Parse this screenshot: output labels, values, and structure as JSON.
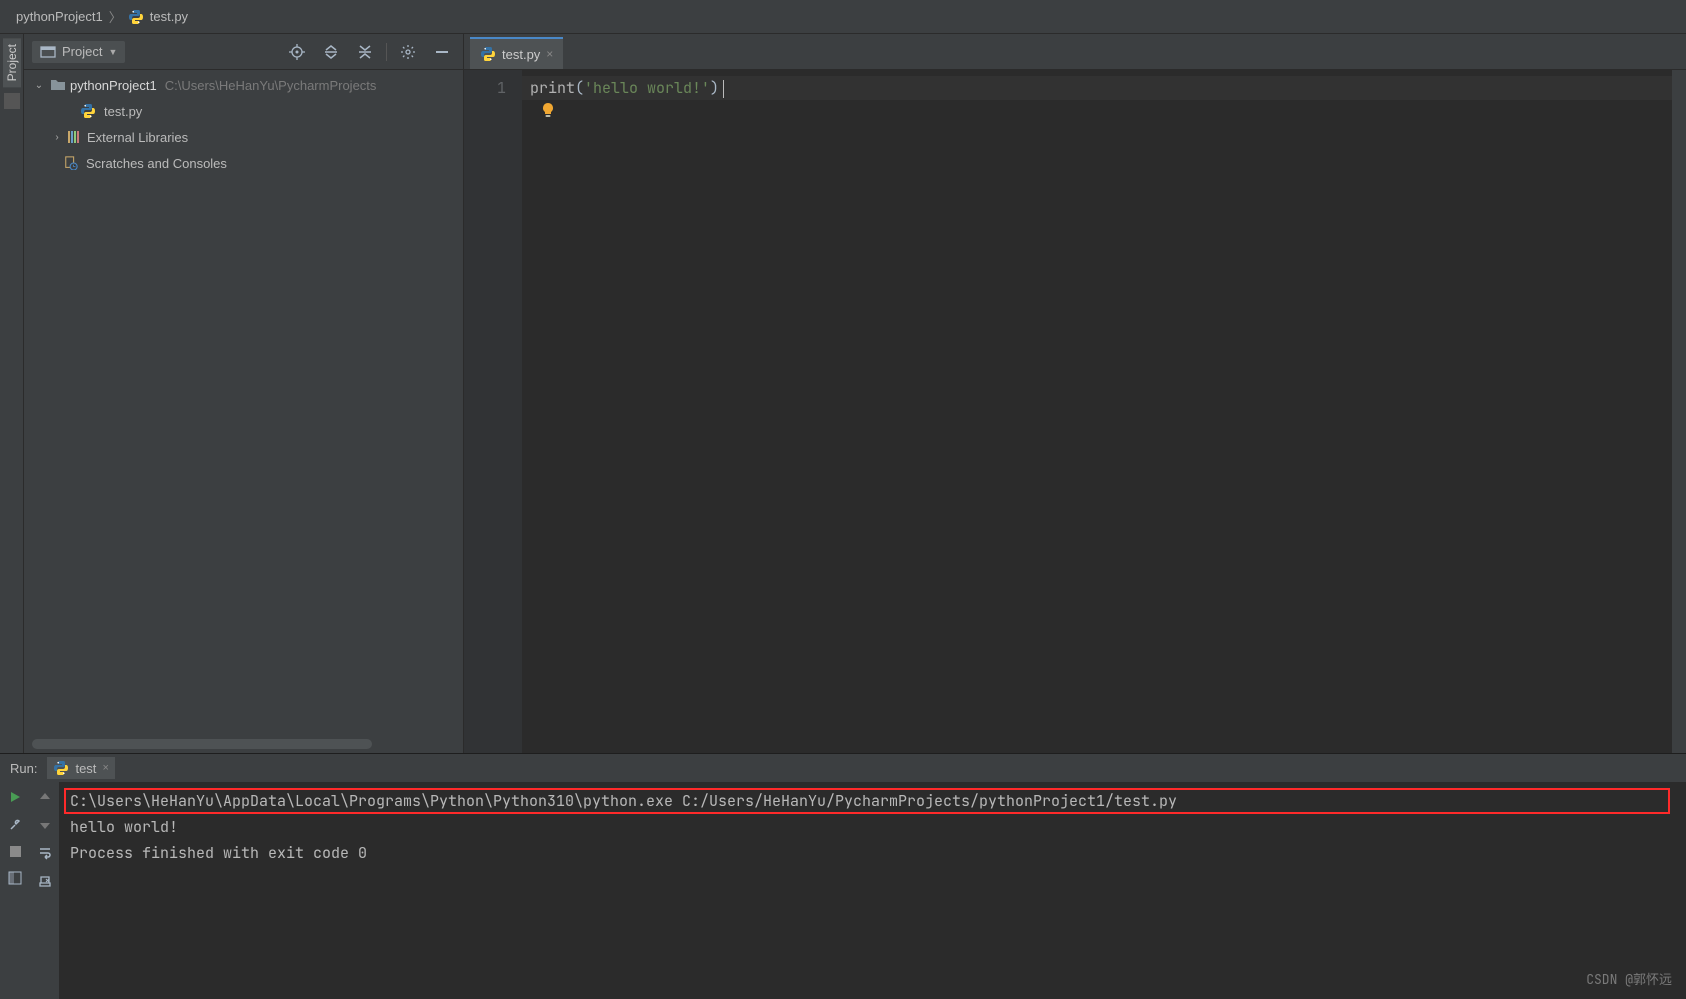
{
  "breadcrumb": {
    "project": "pythonProject1",
    "file": "test.py"
  },
  "leftRail": {
    "projectLabel": "Project"
  },
  "projectPane": {
    "viewLabel": "Project",
    "root": {
      "name": "pythonProject1",
      "path": "C:\\Users\\HeHanYu\\PycharmProjects"
    },
    "files": [
      {
        "name": "test.py"
      }
    ],
    "externalLibraries": "External Libraries",
    "scratches": "Scratches and Consoles"
  },
  "editor": {
    "tab": {
      "name": "test.py"
    },
    "gutter": {
      "line1": "1"
    },
    "code": {
      "fn": "print",
      "open": "(",
      "str": "'hello world!'",
      "close": ")"
    }
  },
  "run": {
    "label": "Run:",
    "tabName": "test",
    "lines": {
      "cmd": "C:\\Users\\HeHanYu\\AppData\\Local\\Programs\\Python\\Python310\\python.exe C:/Users/HeHanYu/PycharmProjects/pythonProject1/test.py",
      "out": "hello world!",
      "blank": "",
      "exit": "Process finished with exit code 0"
    }
  },
  "watermark": "CSDN @郭怀远"
}
